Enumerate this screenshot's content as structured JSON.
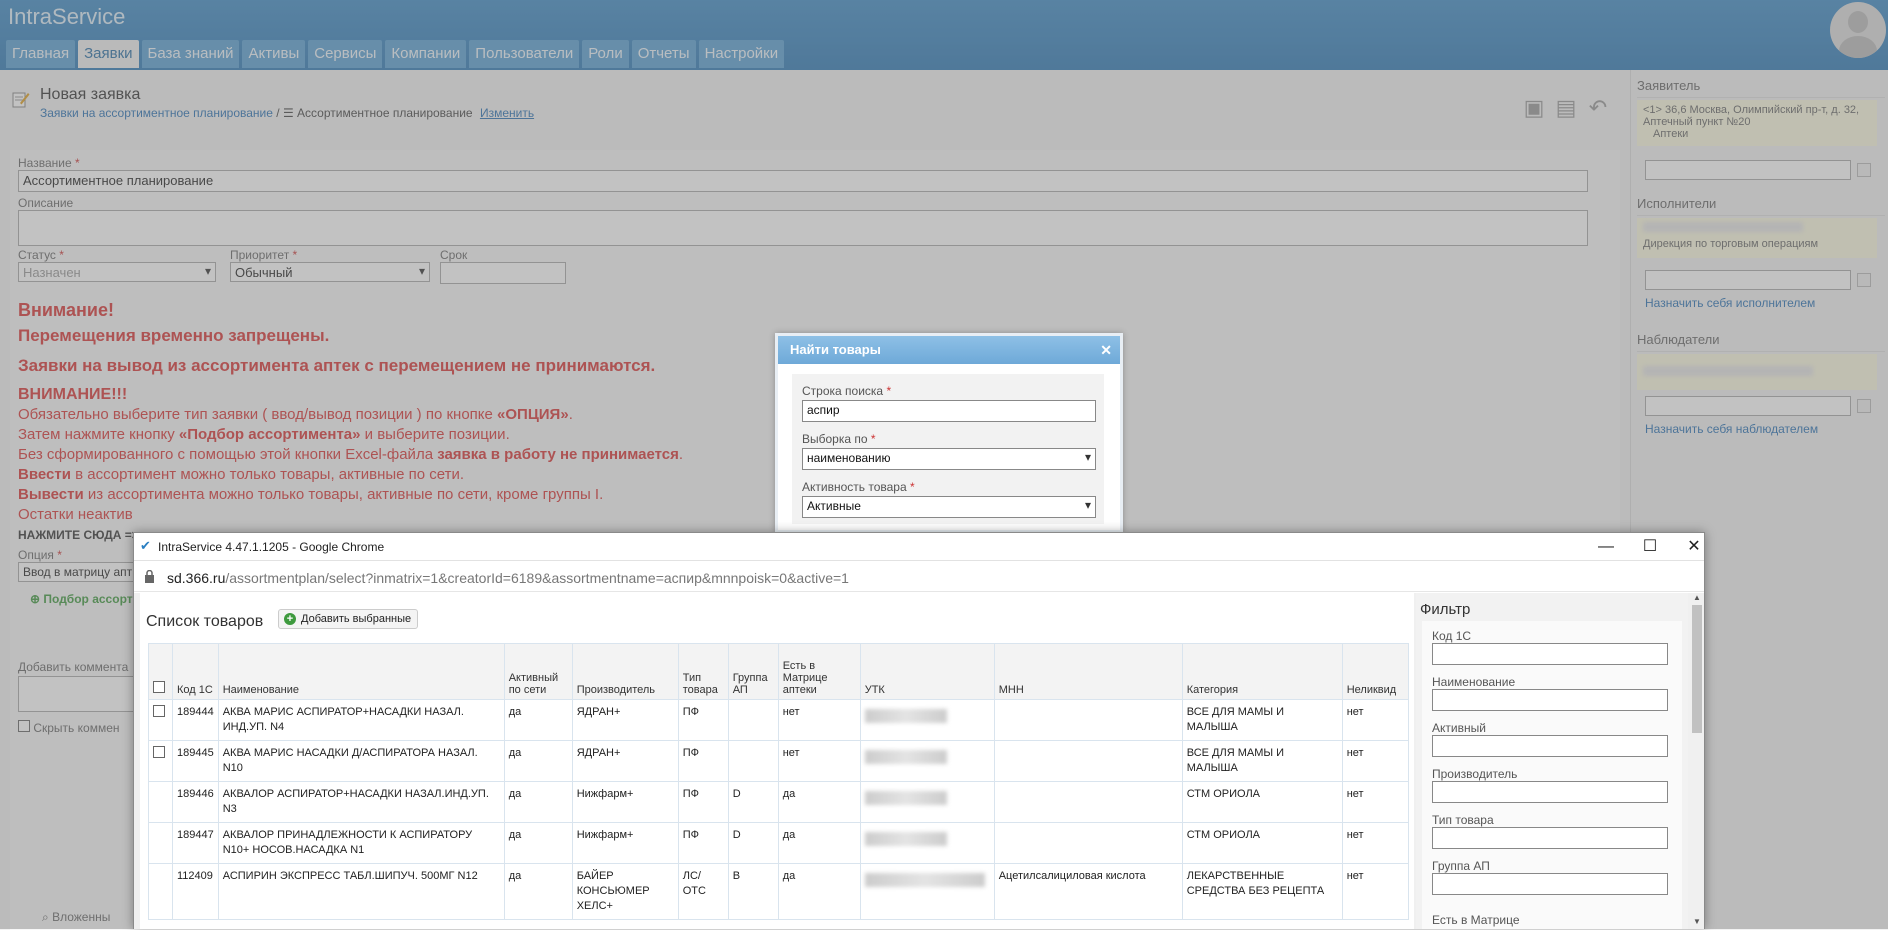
{
  "app": {
    "name": "IntraService"
  },
  "nav": [
    "Главная",
    "Заявки",
    "База знаний",
    "Активы",
    "Сервисы",
    "Компании",
    "Пользователи",
    "Роли",
    "Отчеты",
    "Настройки"
  ],
  "page": {
    "title": "Новая заявка",
    "breadcrumb_link": "Заявки на ассортиментное планирование",
    "breadcrumb_sep": " / ",
    "breadcrumb_current": "Ассортиментное планирование",
    "breadcrumb_edit": "Изменить"
  },
  "form": {
    "name_label": "Название",
    "name_value": "Ассортиментное планирование",
    "desc_label": "Описание",
    "status_label": "Статус",
    "status_value": "Назначен",
    "priority_label": "Приоритет",
    "priority_value": "Обычный",
    "due_label": "Срок",
    "click_here": "НАЖМИТЕ СЮДА =>",
    "option_label": "Опция",
    "option_value": "Ввод в матрицу апт",
    "pick_label": "Подбор ассорт",
    "comment_label": "Добавить коммента",
    "hide_comment": "Скрыть коммен",
    "attachments": "Вложенны"
  },
  "warnings": {
    "title": "Внимание!",
    "line1": "Перемещения временно запрещены.",
    "line2": "Заявки на вывод из ассортимента аптек с перемещением не принимаются.",
    "attention": "ВНИМАНИЕ!!!",
    "t1a": "Обязательно выберите тип заявки ( ввод/вывод позиции ) по кнопке ",
    "t1b": "«ОПЦИЯ»",
    "t1c": ".",
    "t2a": "Затем нажмите кнопку ",
    "t2b": "«Подбор ассортимента»",
    "t2c": " и выберите позиции.",
    "t3a": "Без сформированного с помощью этой кнопки Excel-файла ",
    "t3b": "заявка в работу не принимается",
    "t3c": ".",
    "t4a": "Ввести",
    "t4b": " в ассортимент можно только товары, активные по сети.",
    "t5a": "Вывести",
    "t5b": " из ассортимента можно только товары, активные по сети, кроме группы I.",
    "t6": "Остатки неактив"
  },
  "sidebar": {
    "applicant_h": "Заявитель",
    "applicant_text": "<1> 36,6 Москва, Олимпийский пр-т, д. 32, Аптечный пункт №20",
    "applicant_sub": "Аптеки",
    "executors_h": "Исполнители",
    "executors_sub": "Дирекция по торговым операциям",
    "assign_exec": "Назначить себя исполнителем",
    "observers_h": "Наблюдатели",
    "assign_obs": "Назначить себя наблюдателем"
  },
  "modal": {
    "title": "Найти товары",
    "search_label": "Строка поиска",
    "search_value": "аспир",
    "by_label": "Выборка по",
    "by_value": "наименованию",
    "activity_label": "Активность товара",
    "activity_value": "Активные"
  },
  "chrome": {
    "title": "IntraService 4.47.1.1205 - Google Chrome",
    "url_host": "sd.366.ru",
    "url_path": "/assortmentplan/select?inmatrix=1&creatorId=6189&assortmentname=аспир&mnnpoisk=0&active=1",
    "minimize": "—",
    "maximize": "☐",
    "close": "✕"
  },
  "list": {
    "title": "Список товаров",
    "add_selected": "Добавить выбранные",
    "columns": [
      "Код 1С",
      "Наименование",
      "Активный по сети",
      "Производитель",
      "Тип товара",
      "Группа АП",
      "Есть в Матрице аптеки",
      "УТК",
      "МНН",
      "Категория",
      "Неликвид"
    ],
    "rows": [
      {
        "code": "189444",
        "name": "АКВА МАРИС АСПИРАТОР+НАСАДКИ НАЗАЛ. ИНД.УП. N4",
        "active": "да",
        "maker": "ЯДРАН+",
        "type": "ПФ",
        "group": "",
        "matrix": "нет",
        "mnn": "",
        "cat": "ВСЕ ДЛЯ МАМЫ И МАЛЫША",
        "illiq": "нет",
        "check": true
      },
      {
        "code": "189445",
        "name": "АКВА МАРИС НАСАДКИ Д/АСПИРАТОРА НАЗАЛ. N10",
        "active": "да",
        "maker": "ЯДРАН+",
        "type": "ПФ",
        "group": "",
        "matrix": "нет",
        "mnn": "",
        "cat": "ВСЕ ДЛЯ МАМЫ И МАЛЫША",
        "illiq": "нет",
        "check": true
      },
      {
        "code": "189446",
        "name": "АКВАЛОР АСПИРАТОР+НАСАДКИ НАЗАЛ.ИНД.УП. N3",
        "active": "да",
        "maker": "Нижфарм+",
        "type": "ПФ",
        "group": "D",
        "matrix": "да",
        "mnn": "",
        "cat": "СТМ ОРИОЛА",
        "illiq": "нет",
        "check": false
      },
      {
        "code": "189447",
        "name": "АКВАЛОР ПРИНАДЛЕЖНОСТИ К АСПИРАТОРУ N10+ НОСОВ.НАСАДКА N1",
        "active": "да",
        "maker": "Нижфарм+",
        "type": "ПФ",
        "group": "D",
        "matrix": "да",
        "mnn": "",
        "cat": "СТМ ОРИОЛА",
        "illiq": "нет",
        "check": false
      },
      {
        "code": "112409",
        "name": "АСПИРИН ЭКСПРЕСС ТАБЛ.ШИПУЧ. 500МГ N12",
        "active": "да",
        "maker": "БАЙЕР КОНСЬЮМЕР ХЕЛС+",
        "type": "ЛС/ОТС",
        "group": "B",
        "matrix": "да",
        "mnn": "Ацетилсалициловая кислота",
        "cat": "ЛЕКАРСТВЕННЫЕ СРЕДСТВА БЕЗ РЕЦЕПТА",
        "illiq": "нет",
        "check": false
      }
    ]
  },
  "filter": {
    "title": "Фильтр",
    "fields": [
      "Код 1С",
      "Наименование",
      "Активный",
      "Производитель",
      "Тип товара",
      "Группа АП",
      "Есть в Матрице"
    ]
  },
  "colors": {
    "header": "#3f8cc6",
    "link": "#2a72b5",
    "warning": "#d93636",
    "modal_header": "#6ea9d8"
  }
}
